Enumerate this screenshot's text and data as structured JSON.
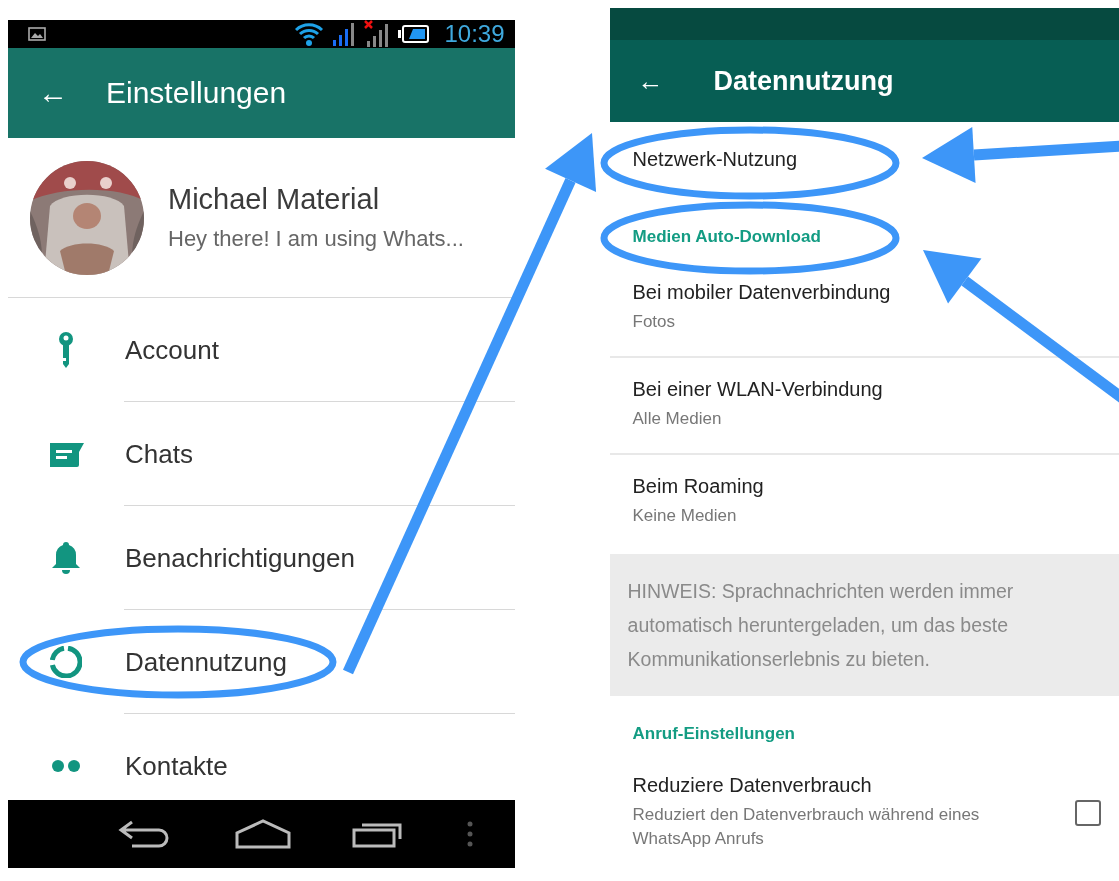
{
  "left_screen": {
    "status_bar": {
      "time": "10:39"
    },
    "toolbar": {
      "back": "←",
      "title": "Einstellungen"
    },
    "profile": {
      "name": "Michael Material",
      "status": "Hey there! I am using Whats..."
    },
    "menu": [
      {
        "kind": "key",
        "label": "Account",
        "highlighted": false
      },
      {
        "kind": "chat",
        "label": "Chats",
        "highlighted": false
      },
      {
        "kind": "bell",
        "label": "Benachrichtigungen",
        "highlighted": false
      },
      {
        "kind": "data",
        "label": "Datennutzung",
        "highlighted": true
      },
      {
        "kind": "contacts",
        "label": "Kontakte",
        "highlighted": false
      }
    ]
  },
  "right_screen": {
    "toolbar": {
      "back": "←",
      "title": "Datennutzung"
    },
    "items": [
      {
        "kind": "item",
        "title": "Netzwerk-Nutzung",
        "highlighted": true
      },
      {
        "kind": "header",
        "title": "Medien Auto-Download",
        "highlighted": true
      },
      {
        "kind": "item",
        "title": "Bei mobiler Datenverbindung",
        "subtitle": "Fotos"
      },
      {
        "kind": "item",
        "title": "Bei einer WLAN-Verbindung",
        "subtitle": "Alle Medien"
      },
      {
        "kind": "item",
        "title": "Beim Roaming",
        "subtitle": "Keine Medien"
      },
      {
        "kind": "note",
        "title": "HINWEIS: Sprachnachrichten werden immer automatisch heruntergeladen, um das beste Kommunikationserlebnis zu bieten."
      },
      {
        "kind": "header",
        "title": "Anruf-Einstellungen"
      },
      {
        "kind": "checkbox",
        "title": "Reduziere Datenverbrauch",
        "subtitle": "Reduziert den Datenverbrauch während eines WhatsApp Anrufs",
        "checked": false
      }
    ]
  }
}
